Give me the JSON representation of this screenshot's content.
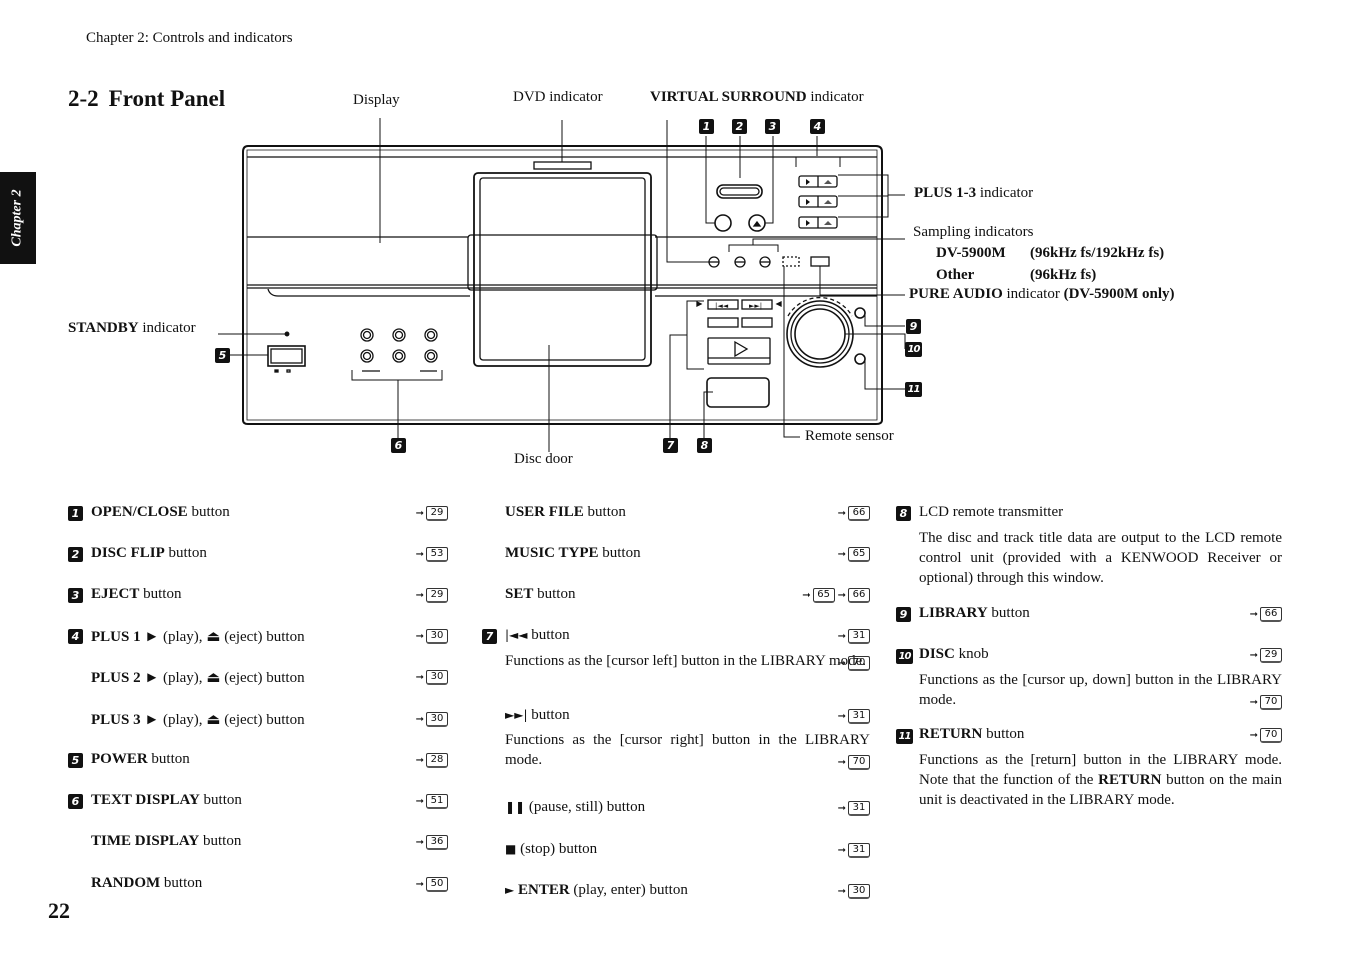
{
  "running_head": "Chapter 2: Controls and indicators",
  "chapter_tab": "Chapter 2",
  "section": {
    "number": "2-2",
    "title": "Front Panel"
  },
  "page_number": "22",
  "diagram_callouts": {
    "display": "Display",
    "dvd_indicator": "DVD indicator",
    "virtual_surround_bold": "VIRTUAL SURROUND",
    "virtual_surround_rest": " indicator",
    "plus_bold": "PLUS 1-3",
    "plus_rest": " indicator",
    "sampling_title": "Sampling indicators",
    "sampling_model_1": "DV-5900M",
    "sampling_value_1": "(96kHz fs/192kHz fs)",
    "sampling_model_2": "Other",
    "sampling_value_2": "(96kHz fs)",
    "pure_audio_bold": "PURE AUDIO",
    "pure_audio_rest": " indicator ",
    "pure_audio_note": "(DV-5900M only)",
    "standby_bold": "STANDBY",
    "standby_rest": " indicator",
    "remote_sensor": "Remote sensor",
    "disc_door": "Disc door",
    "badges": [
      "1",
      "2",
      "3",
      "4",
      "5",
      "6",
      "7",
      "8",
      "9",
      "10",
      "11"
    ]
  },
  "descriptions": {
    "col1": [
      {
        "badge": "1",
        "bold": "OPEN/CLOSE",
        "rest": " button",
        "refs": [
          "29"
        ]
      },
      {
        "badge": "2",
        "bold": "DISC FLIP",
        "rest": " button",
        "refs": [
          "53"
        ]
      },
      {
        "badge": "3",
        "bold": "EJECT",
        "rest": " button",
        "refs": [
          "29"
        ]
      },
      {
        "badge": "4",
        "bold": "PLUS 1 ►",
        "rest": " (play),  ⏏ (eject) button",
        "refs": [
          "30"
        ]
      },
      {
        "badge": "",
        "bold": "PLUS 2 ►",
        "rest": " (play),  ⏏ (eject) button",
        "refs": [
          "30"
        ]
      },
      {
        "badge": "",
        "bold": "PLUS 3 ►",
        "rest": " (play),  ⏏ (eject) button",
        "refs": [
          "30"
        ]
      },
      {
        "badge": "5",
        "bold": "POWER",
        "rest": " button",
        "refs": [
          "28"
        ]
      },
      {
        "badge": "6",
        "bold": "TEXT DISPLAY",
        "rest": " button",
        "refs": [
          "51"
        ]
      },
      {
        "badge": "",
        "bold": "TIME DISPLAY",
        "rest": " button",
        "refs": [
          "36"
        ]
      },
      {
        "badge": "",
        "bold": "RANDOM",
        "rest": " button",
        "refs": [
          "50"
        ]
      }
    ],
    "col2": [
      {
        "badge": "",
        "bold": "USER FILE",
        "rest": " button",
        "refs": [
          "66"
        ]
      },
      {
        "badge": "",
        "bold": "MUSIC TYPE",
        "rest": " button",
        "refs": [
          "65"
        ]
      },
      {
        "badge": "",
        "bold": "SET",
        "rest": " button",
        "refs": [
          "65",
          "66"
        ]
      },
      {
        "badge": "7",
        "symbol": "|◄◄",
        "rest": " button",
        "refs": [
          "31"
        ],
        "desc": "Functions as the [cursor left] button in the LIBRARY mode.",
        "desc_refs": [
          "70"
        ]
      },
      {
        "badge": "",
        "symbol": "►►|",
        "rest": " button",
        "refs": [
          "31"
        ],
        "desc": "Functions as the [cursor right] button in the LIBRARY mode.",
        "desc_refs": [
          "70"
        ]
      },
      {
        "badge": "",
        "symbol": "❚❚",
        "rest": " (pause, still) button",
        "refs": [
          "31"
        ]
      },
      {
        "badge": "",
        "symbol": "■",
        "rest": " (stop) button",
        "refs": [
          "31"
        ]
      },
      {
        "badge": "",
        "symbol": "►",
        "bold": " ENTER",
        "rest": " (play, enter) button",
        "refs": [
          "30"
        ]
      }
    ],
    "col3": [
      {
        "badge": "8",
        "rest": "LCD remote transmitter",
        "refs": [],
        "desc": "The disc and track title data are output to the LCD remote control unit (provided with a KENWOOD Receiver or optional) through this window.",
        "desc_refs": []
      },
      {
        "badge": "9",
        "bold": "LIBRARY",
        "rest": " button",
        "refs": [
          "66"
        ]
      },
      {
        "badge": "10",
        "bold": "DISC",
        "rest": " knob",
        "refs": [
          "29"
        ],
        "desc": "Functions as the [cursor up, down] button in the LIBRARY mode.",
        "desc_refs": [
          "70"
        ]
      },
      {
        "badge": "11",
        "bold": "RETURN",
        "rest": " button",
        "refs": [
          "70"
        ],
        "desc_pre": "Functions as the [return] button in the LIBRARY mode.  Note that the function of the ",
        "desc_bold": "RETURN",
        "desc_post": " button on the main unit is deactivated in the LIBRARY mode.",
        "desc_refs": []
      }
    ]
  }
}
